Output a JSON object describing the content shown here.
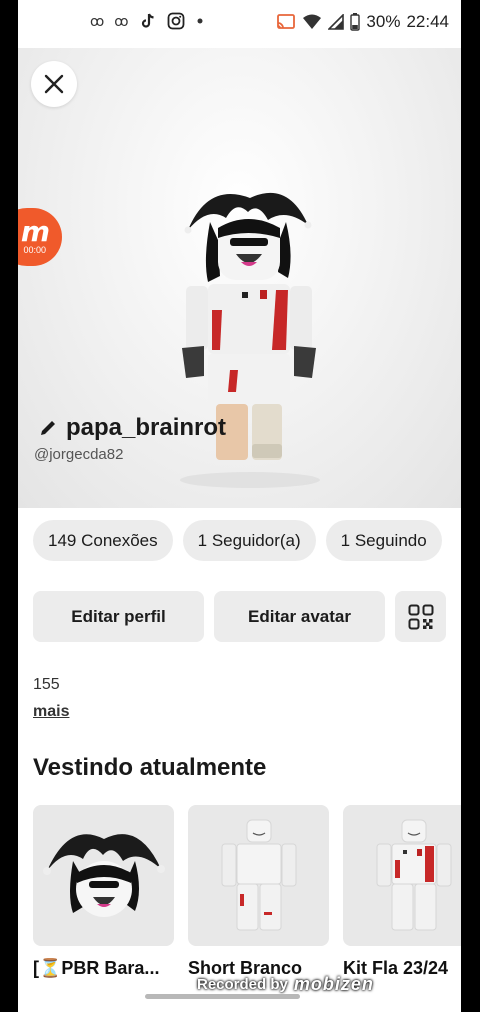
{
  "status_bar": {
    "battery": "30%",
    "time": "22:44",
    "left_icons": [
      "notification-icon",
      "notification-icon",
      "tiktok-icon",
      "instagram-icon",
      "dot-icon"
    ]
  },
  "profile": {
    "display_name": "papa_brainrot",
    "handle": "@jorgecda82"
  },
  "stats": {
    "connections": "149 Conexões",
    "followers": "1 Seguidor(a)",
    "following": "1 Seguindo"
  },
  "actions": {
    "edit_profile": "Editar perfil",
    "edit_avatar": "Editar avatar"
  },
  "bio": {
    "text": "155",
    "more": "mais"
  },
  "wearing": {
    "title": "Vestindo atualmente",
    "items": [
      {
        "name": "[⏳PBR Bara..."
      },
      {
        "name": "Short Branco"
      },
      {
        "name": "Kit Fla 23/24"
      }
    ]
  },
  "recorder": {
    "logo": "m",
    "timer": "00:00",
    "watermark_prefix": "Recorded by",
    "watermark_brand": "mobizen"
  },
  "colors": {
    "accent_recorder": "#f05a2b",
    "chip_bg": "#ececec",
    "jersey_red": "#d42a2a"
  }
}
